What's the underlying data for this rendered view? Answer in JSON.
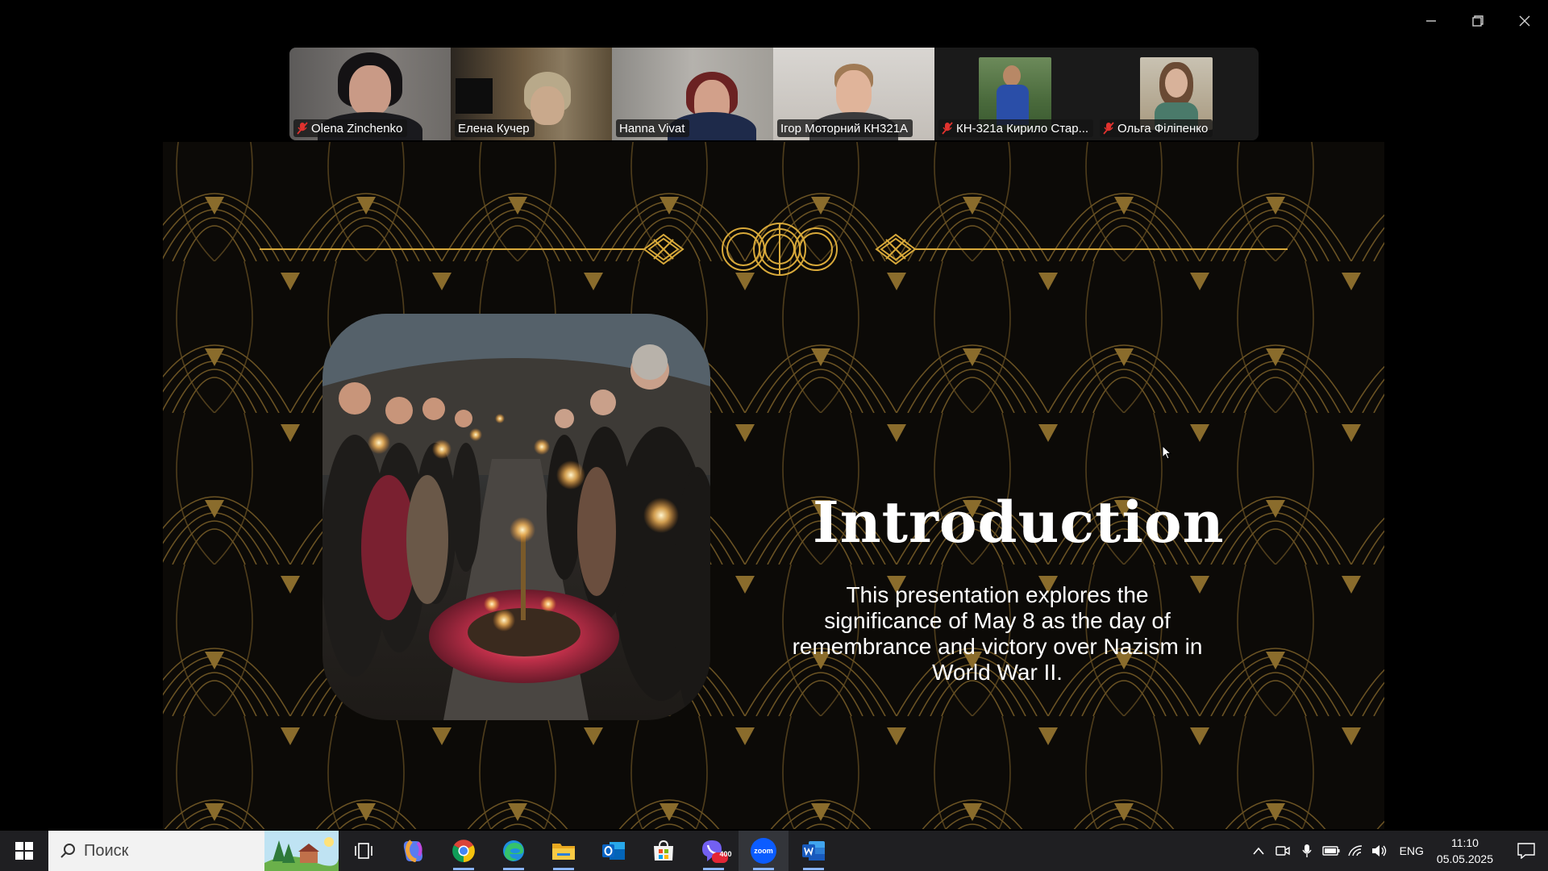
{
  "window": {
    "controls": [
      "minimize",
      "restore",
      "close"
    ]
  },
  "participants": [
    {
      "name": "Olena Zinchenko",
      "muted": true,
      "active": false
    },
    {
      "name": "Елена Кучер",
      "muted": false,
      "active": false
    },
    {
      "name": "Hanna Vivat",
      "muted": false,
      "active": false
    },
    {
      "name": "Ігор Моторний КН321А",
      "muted": false,
      "active": true
    },
    {
      "name": "КН-321а Кирило Стар...",
      "muted": true,
      "active": false
    },
    {
      "name": "Ольга Філіпенко",
      "muted": true,
      "active": false
    }
  ],
  "slide": {
    "title": "Introduction",
    "body": "This presentation explores the significance of May 8 as the day of remembrance and victory over Nazism in World War II.",
    "colors": {
      "background": "#0c0a07",
      "gold": "#d8a93a",
      "pattern": "#6b5323"
    }
  },
  "taskbar": {
    "search_placeholder": "Поиск",
    "apps": [
      {
        "name": "task-view-icon"
      },
      {
        "name": "copilot-icon"
      },
      {
        "name": "chrome-icon"
      },
      {
        "name": "edge-icon"
      },
      {
        "name": "file-explorer-icon"
      },
      {
        "name": "outlook-icon"
      },
      {
        "name": "store-icon"
      },
      {
        "name": "viber-icon",
        "badge": "400"
      },
      {
        "name": "zoom-icon",
        "label": "zoom"
      },
      {
        "name": "word-icon"
      }
    ],
    "language": "ENG",
    "time": "11:10",
    "date": "05.05.2025"
  }
}
